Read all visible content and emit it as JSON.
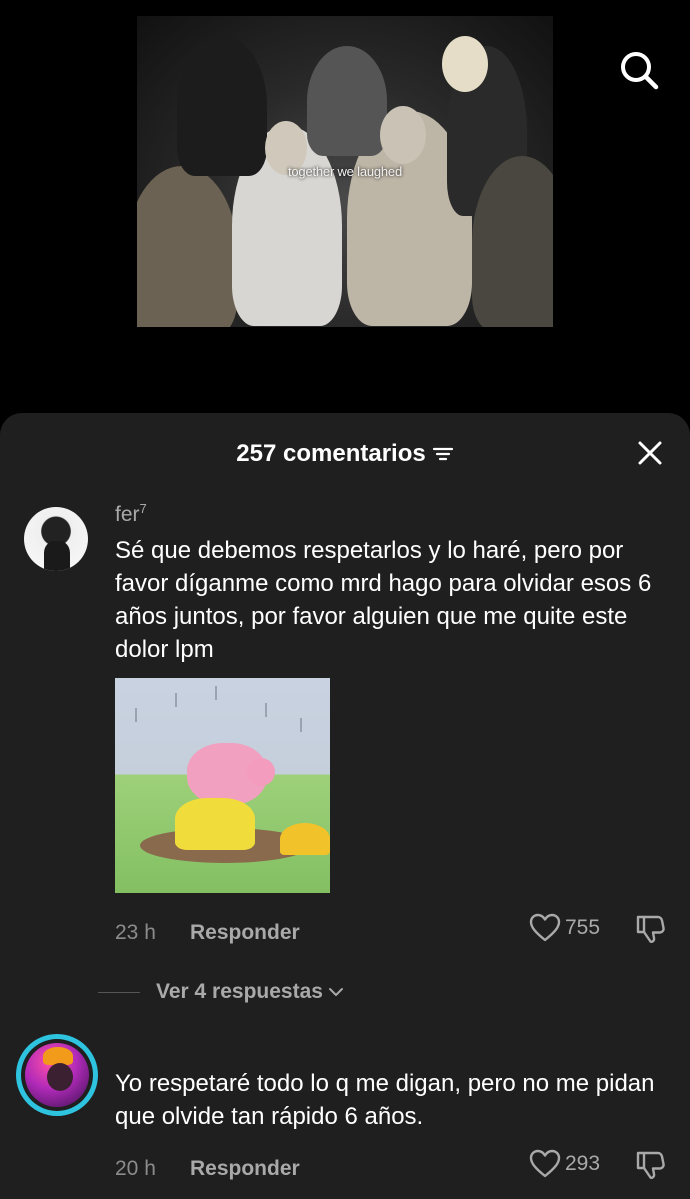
{
  "video": {
    "caption": "together we laughed"
  },
  "icons": {
    "search": "search-icon",
    "filter": "filter-icon",
    "close": "close-icon",
    "like": "heart-icon",
    "dislike": "dislike-icon",
    "chevron": "chevron-down-icon"
  },
  "comments_sheet": {
    "count_label": "257 comentarios",
    "comments": [
      {
        "username": "fer",
        "username_sup": "7",
        "text": "Sé que debemos respetarlos y lo haré, pero por favor díganme como mrd hago para olvidar esos 6 años juntos, por favor alguien que me quite este dolor lpm",
        "time": "23 h",
        "reply_label": "Responder",
        "likes": "755",
        "view_replies": "Ver 4 respuestas"
      },
      {
        "username": "",
        "text": "Yo respetaré todo lo q me digan, pero no me pidan que olvide tan rápido 6 años.",
        "time": "20 h",
        "reply_label": "Responder",
        "likes": "293"
      }
    ]
  },
  "colors": {
    "sheet_bg": "#1f1f1f",
    "secondary_text": "#a9a9a9",
    "avatar_ring": "#2ec4e0"
  }
}
